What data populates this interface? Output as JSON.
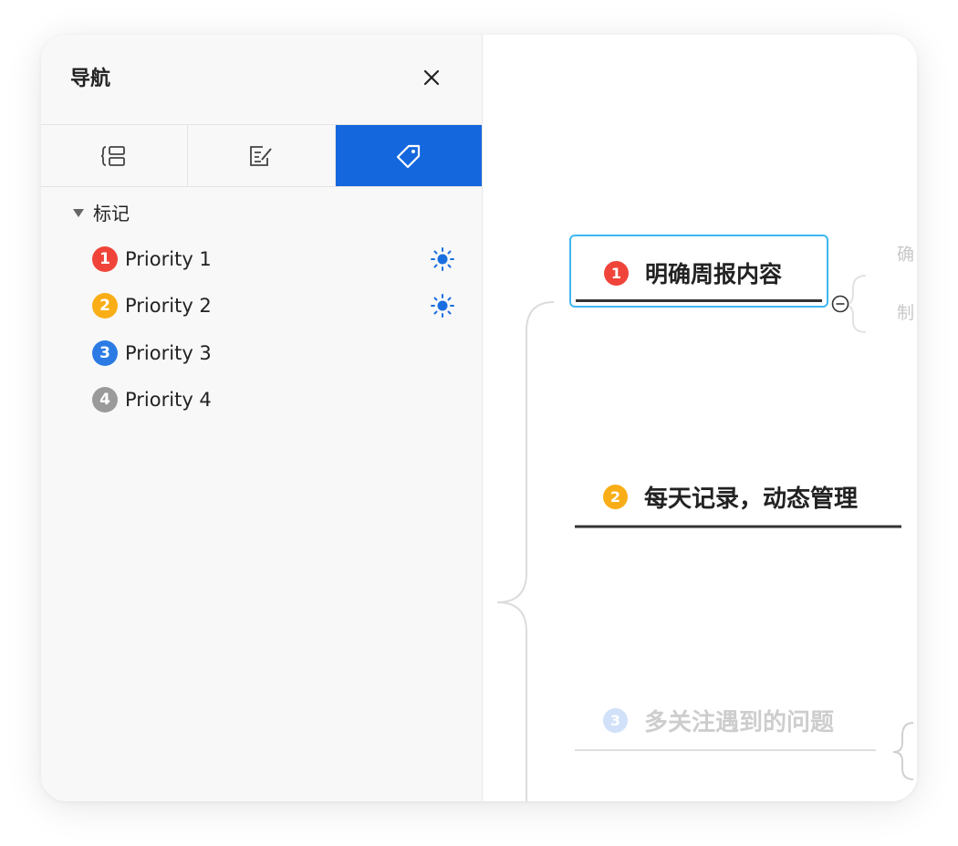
{
  "panel": {
    "title": "导航",
    "tabs": [
      {
        "name": "outline-tab",
        "icon": "outline-icon"
      },
      {
        "name": "notes-tab",
        "icon": "edit-note-icon"
      },
      {
        "name": "markers-tab",
        "icon": "tag-icon",
        "active": true
      }
    ],
    "section_label": "标记",
    "priorities": [
      {
        "num": "1",
        "label": "Priority 1",
        "color": "#f0443a",
        "filter": true
      },
      {
        "num": "2",
        "label": "Priority 2",
        "color": "#f9ae17",
        "filter": true
      },
      {
        "num": "3",
        "label": "Priority 3",
        "color": "#2c7be5",
        "filter": false
      },
      {
        "num": "4",
        "label": "Priority 4",
        "color": "#9a9a9a",
        "filter": false
      }
    ]
  },
  "mindmap": {
    "nodes": [
      {
        "num": "1",
        "text": "明确周报内容",
        "color": "#f0443a",
        "selected": true
      },
      {
        "num": "2",
        "text": "每天记录，动态管理",
        "color": "#f9ae17"
      },
      {
        "num": "3",
        "text": "多关注遇到的问题",
        "color": "#2c7be5",
        "faded": true
      }
    ],
    "child_text_1": "确",
    "child_text_2": "制"
  },
  "colors": {
    "accent": "#1467dd",
    "selection_border": "#3fb7ef"
  }
}
